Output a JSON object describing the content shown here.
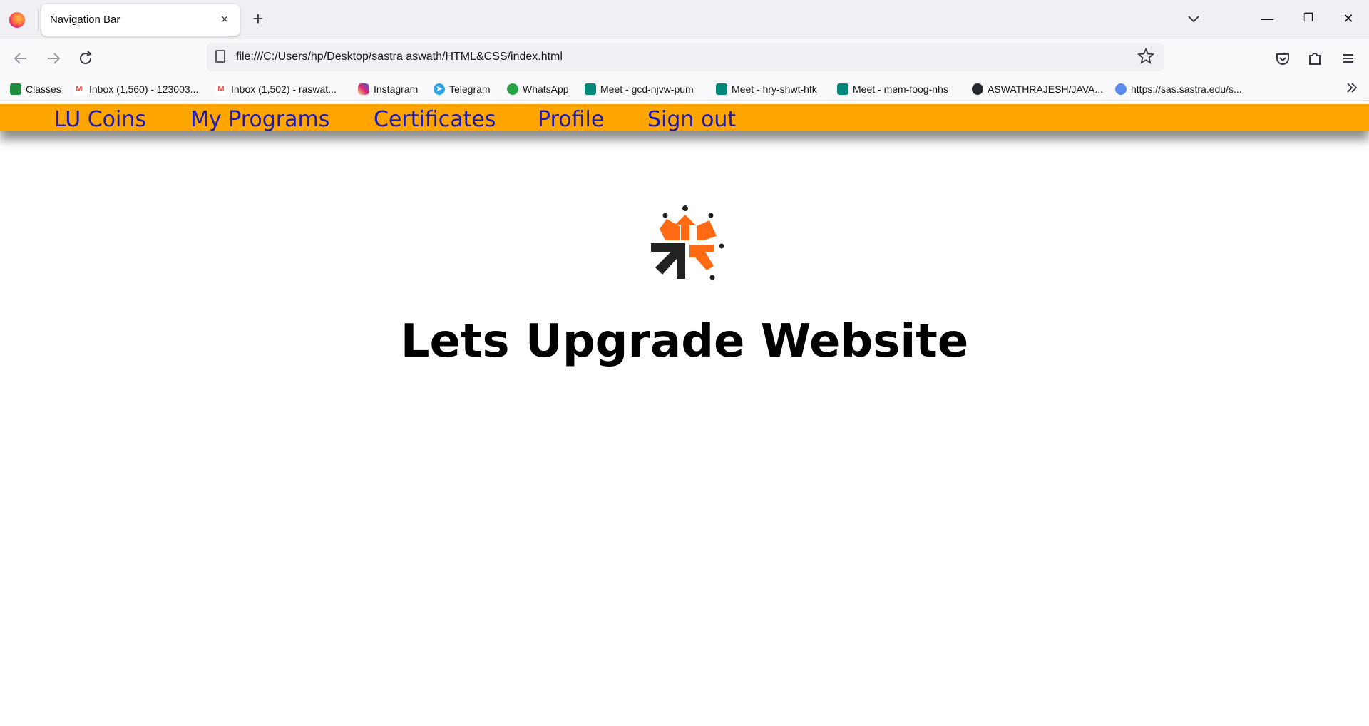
{
  "browser": {
    "tab_title": "Navigation Bar",
    "tab_close": "×",
    "new_tab": "+",
    "url": "file:///C:/Users/hp/Desktop/sastra aswath/HTML&CSS/index.html",
    "window_controls": {
      "minimize": "—",
      "restore": "❐",
      "close": "✕"
    }
  },
  "bookmarks": [
    {
      "label": "Classes",
      "icon": "google-classroom-icon",
      "color": "#1e8e3e"
    },
    {
      "label": "Inbox (1,560) - 123003...",
      "icon": "gmail-icon",
      "color": "#ea4335"
    },
    {
      "label": "Inbox (1,502) - raswat...",
      "icon": "gmail-icon",
      "color": "#ea4335"
    },
    {
      "label": "Instagram",
      "icon": "instagram-icon",
      "color": "#d62976"
    },
    {
      "label": "Telegram",
      "icon": "telegram-icon",
      "color": "#2aa3e0"
    },
    {
      "label": "WhatsApp",
      "icon": "whatsapp-icon",
      "color": "#25a244"
    },
    {
      "label": "Meet - gcd-njvw-pum",
      "icon": "google-meet-icon",
      "color": "#00897b"
    },
    {
      "label": "Meet - hry-shwt-hfk",
      "icon": "google-meet-icon",
      "color": "#00897b"
    },
    {
      "label": "Meet - mem-foog-nhs",
      "icon": "google-meet-icon",
      "color": "#00897b"
    },
    {
      "label": "ASWATHRAJESH/JAVA...",
      "icon": "github-icon",
      "color": "#24292f"
    },
    {
      "label": "https://sas.sastra.edu/s...",
      "icon": "globe-icon",
      "color": "#5b8def"
    }
  ],
  "site": {
    "nav_color": "#ffa500",
    "link_color": "#1a1ab8",
    "nav_links": [
      "LU Coins",
      "My Programs",
      "Certificates",
      "Profile",
      "Sign out"
    ],
    "heading": "Lets Upgrade Website",
    "logo_colors": {
      "orange": "#ff6a13",
      "dark": "#222222"
    }
  }
}
